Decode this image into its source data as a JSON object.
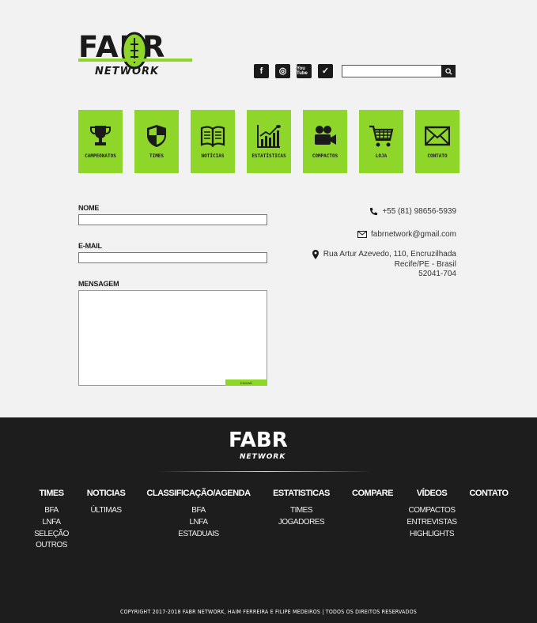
{
  "brand": {
    "logo_top": "FABR",
    "logo_bottom": "NETWORK",
    "accent_color": "#8fd62a"
  },
  "social": [
    {
      "name": "facebook-icon",
      "glyph": "f"
    },
    {
      "name": "instagram-icon",
      "glyph": "◎"
    },
    {
      "name": "youtube-icon",
      "glyph": "You Tube"
    },
    {
      "name": "twitter-icon",
      "glyph": "✓"
    }
  ],
  "search": {
    "value": "",
    "placeholder": "",
    "icon": "search-icon"
  },
  "nav_tiles": [
    {
      "label": "CAMPEONATOS",
      "icon": "trophy-icon"
    },
    {
      "label": "TIMES",
      "icon": "shield-icon"
    },
    {
      "label": "NOTÍCIAS",
      "icon": "book-icon"
    },
    {
      "label": "ESTATÍSTICAS",
      "icon": "chart-icon"
    },
    {
      "label": "COMPACTOS",
      "icon": "camera-icon"
    },
    {
      "label": "LOJA",
      "icon": "cart-icon"
    },
    {
      "label": "CONTATO",
      "icon": "mail-icon"
    }
  ],
  "form": {
    "name_label": "NOME",
    "name_value": "",
    "email_label": "E-MAIL",
    "email_value": "",
    "message_label": "MENSAGEM",
    "message_value": "",
    "send_label": "ENVIAR"
  },
  "contact": {
    "phone": "+55 (81) 98656-5939",
    "email": "fabrnetwork@gmail.com",
    "address_line1": "Rua Artur Azevedo, 110, Encruzilhada",
    "address_line2": "Recife/PE - Brasil",
    "address_line3": "52041-704"
  },
  "footer": {
    "logo_top": "FABR",
    "logo_bottom": "NETWORK",
    "columns": [
      {
        "heading": "TIMES",
        "items": [
          "BFA",
          "LNFA",
          "SELEÇÃO",
          "OUTROS"
        ]
      },
      {
        "heading": "NOTICIAS",
        "items": [
          "ÚLTIMAS"
        ]
      },
      {
        "heading": "CLASSIFICAÇÃO/AGENDA",
        "items": [
          "BFA",
          "LNFA",
          "ESTADUAIS"
        ]
      },
      {
        "heading": "ESTATISTICAS",
        "items": [
          "TIMES",
          "JOGADORES"
        ]
      },
      {
        "heading": "COMPARE",
        "items": []
      },
      {
        "heading": "VÍDEOS",
        "items": [
          "COMPACTOS",
          "ENTREVISTAS",
          "HIGHLIGHTS"
        ]
      },
      {
        "heading": "CONTATO",
        "items": []
      }
    ],
    "copyright": "COPYRIGHT 2017-2018 FABR NETWORK, HAIM FERREIRA E FILIPE MEDEIROS  |  TODOS OS DIREITOS RESERVADOS"
  }
}
